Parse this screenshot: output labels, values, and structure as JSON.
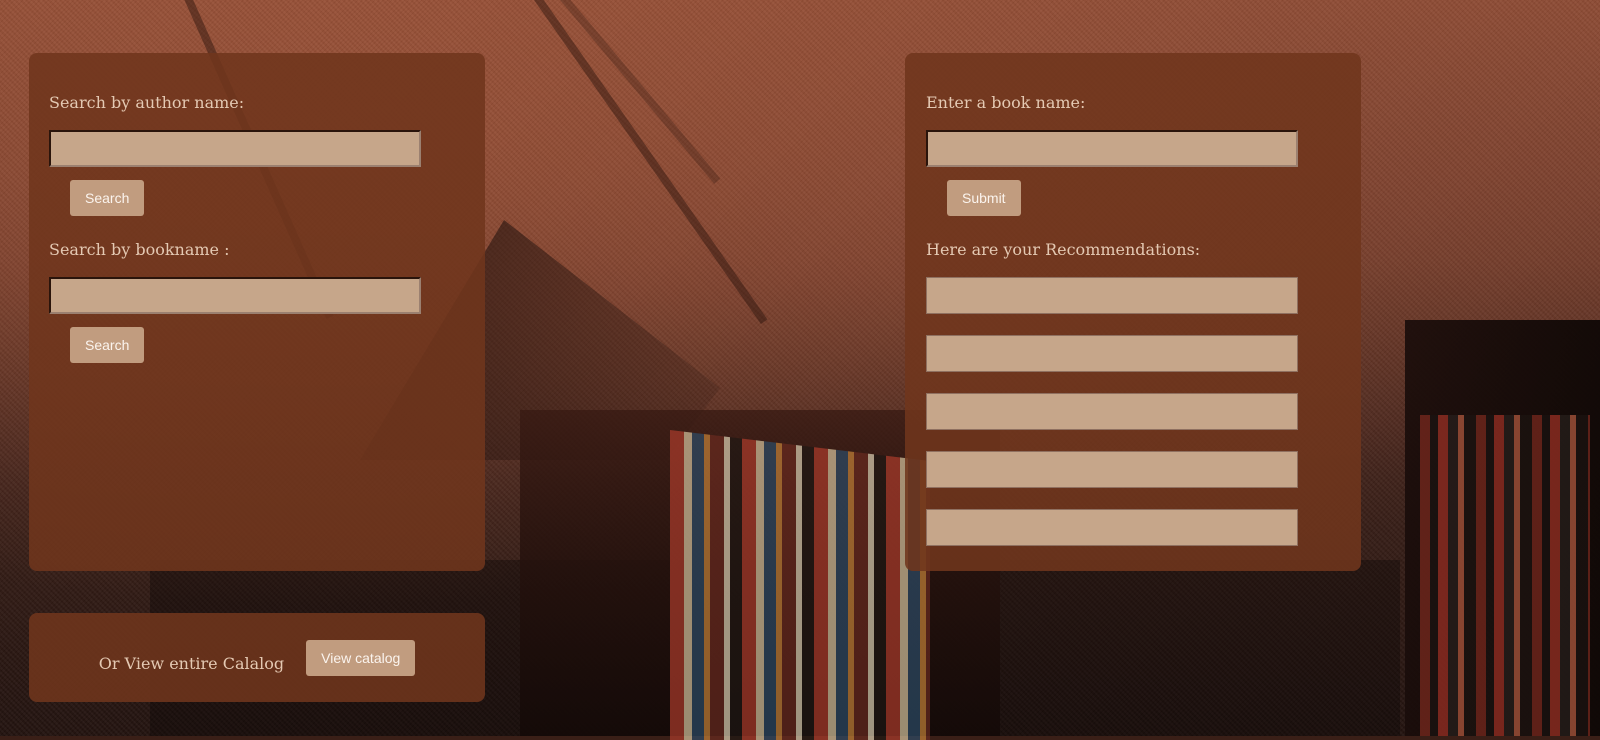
{
  "author_search": {
    "label": "Search by author name:",
    "value": "",
    "placeholder": "",
    "button_label": "Search"
  },
  "bookname_search": {
    "label": "Search by bookname :",
    "value": "",
    "placeholder": "",
    "button_label": "Search"
  },
  "recommend": {
    "input_label": "Enter a book name:",
    "value": "",
    "placeholder": "",
    "submit_label": "Submit",
    "results_label": "Here are your Recommendations:",
    "results": [
      "",
      "",
      "",
      "",
      ""
    ]
  },
  "catalog": {
    "text": "Or View entire Calalog",
    "button_label": "View catalog"
  },
  "colors": {
    "panel": "#6f351d",
    "field": "#c6a68a",
    "button": "#c19c7f",
    "label_text": "#e4c9b3",
    "button_text": "#fbf4ee"
  }
}
